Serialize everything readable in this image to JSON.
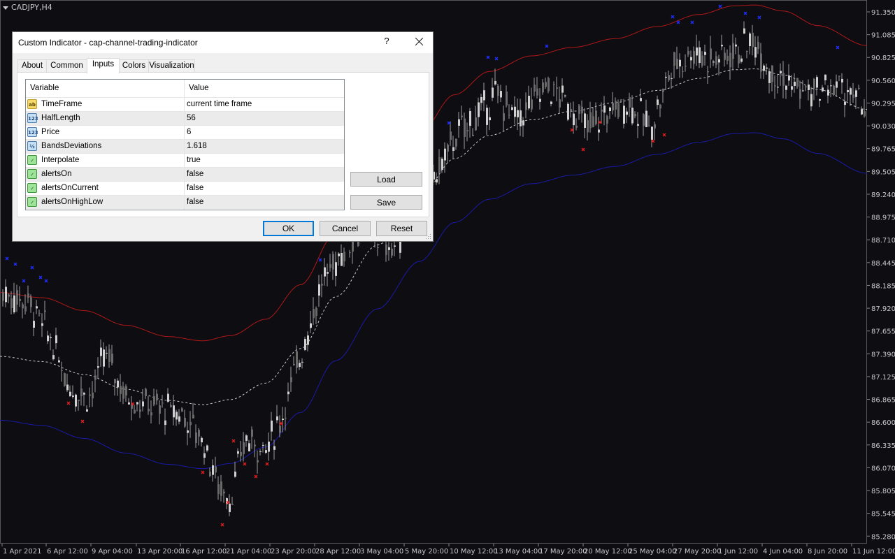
{
  "chart": {
    "symbol": "CADJPY,H4",
    "price_axis_labels": [
      "91.350",
      "91.085",
      "90.825",
      "90.560",
      "90.295",
      "90.030",
      "89.765",
      "89.505",
      "89.240",
      "88.975",
      "88.710",
      "88.445",
      "88.185",
      "87.920",
      "87.655",
      "87.390",
      "87.125",
      "86.865",
      "86.600",
      "86.335",
      "86.070",
      "85.805",
      "85.545",
      "85.280"
    ],
    "time_axis_labels": [
      "1 Apr 2021",
      "6 Apr 12:00",
      "9 Apr 04:00",
      "13 Apr 20:00",
      "16 Apr 12:00",
      "21 Apr 04:00",
      "23 Apr 20:00",
      "28 Apr 12:00",
      "3 May 04:00",
      "5 May 20:00",
      "10 May 12:00",
      "13 May 04:00",
      "17 May 20:00",
      "20 May 12:00",
      "25 May 04:00",
      "27 May 20:00",
      "1 Jun 12:00",
      "4 Jun 04:00",
      "8 Jun 20:00",
      "11 Jun 12:00"
    ],
    "colors": {
      "background": "#0d0d12",
      "candle": "#a0a0a0",
      "upper_band": "#b01818",
      "middle_band": "#c8c8c8",
      "lower_band": "#1a1aa8",
      "high_marker": "#2030ff",
      "low_marker": "#e02020"
    }
  },
  "dialog": {
    "title": "Custom Indicator - cap-channel-trading-indicator",
    "help_label": "?",
    "tabs": [
      {
        "label": "About"
      },
      {
        "label": "Common"
      },
      {
        "label": "Inputs"
      },
      {
        "label": "Colors"
      },
      {
        "label": "Visualization"
      }
    ],
    "active_tab": "Inputs",
    "grid": {
      "col_variable": "Variable",
      "col_value": "Value",
      "rows": [
        {
          "icon": "ab",
          "variable": "TimeFrame",
          "value": "current time frame"
        },
        {
          "icon": "123",
          "variable": "HalfLength",
          "value": "56"
        },
        {
          "icon": "123",
          "variable": "Price",
          "value": "6"
        },
        {
          "icon": "1/2",
          "variable": "BandsDeviations",
          "value": "1.618"
        },
        {
          "icon": "bool",
          "variable": "Interpolate",
          "value": "true"
        },
        {
          "icon": "bool",
          "variable": "alertsOn",
          "value": "false"
        },
        {
          "icon": "bool",
          "variable": "alertsOnCurrent",
          "value": "false"
        },
        {
          "icon": "bool",
          "variable": "alertsOnHighLow",
          "value": "false"
        }
      ]
    },
    "buttons": {
      "load": "Load",
      "save": "Save",
      "ok": "OK",
      "cancel": "Cancel",
      "reset": "Reset"
    }
  }
}
